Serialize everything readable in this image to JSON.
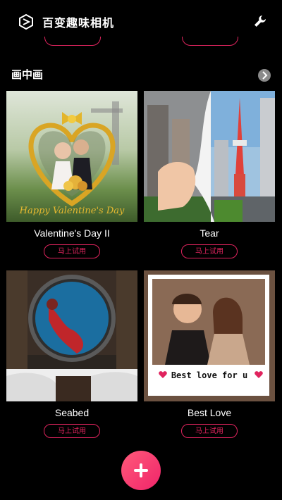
{
  "header": {
    "title": "百变趣味相机",
    "logo_icon": "app-logo-icon",
    "settings_icon": "wrench-icon"
  },
  "section": {
    "title": "画中画",
    "more_icon": "chevron-right-icon"
  },
  "cards": [
    {
      "title": "Valentine's Day II",
      "button": "马上试用",
      "thumb_text": "Happy Valentine's Day"
    },
    {
      "title": "Tear",
      "button": "马上试用"
    },
    {
      "title": "Seabed",
      "button": "马上试用"
    },
    {
      "title": "Best Love",
      "button": "马上试用",
      "thumb_text": "Best love for u"
    }
  ],
  "colors": {
    "accent": "#e0245e",
    "fab": "#f0246a",
    "background": "#000000"
  }
}
